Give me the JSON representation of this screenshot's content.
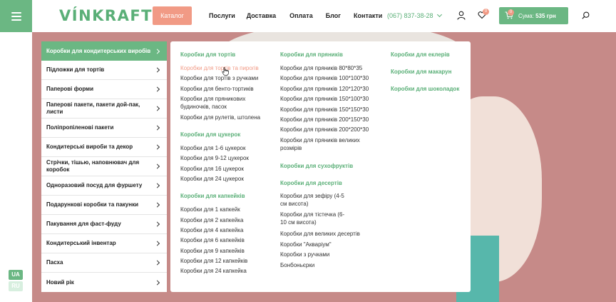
{
  "header": {
    "logo": "VÍNKRAFT",
    "catalog_button": "Каталог",
    "nav": [
      "Послуги",
      "Доставка",
      "Оплата",
      "Блог",
      "Контакти"
    ],
    "phone": "(067) 837-38-28",
    "favorites_count": "0",
    "cart_count": "0",
    "cart_sum_label": "Сума:",
    "cart_sum_value": "535 грн"
  },
  "languages": {
    "ua": "UA",
    "ru": "RU"
  },
  "categories": [
    "Коробки для кондитерських виробів",
    "Підложки для тортів",
    "Паперові форми",
    "Паперові пакети, пакети дой-пак, листи",
    "Поліпропіленові пакети",
    "Кондитерські вироби та декор",
    "Стрічки, тішью, наповнювач для коробок",
    "Одноразовий посуд для фуршету",
    "Подарункові коробки та пакунки",
    "Пакування для фаст-фуду",
    "Кондитерський інвентар",
    "Пасха",
    "Новий рік"
  ],
  "menu": {
    "cakes": {
      "title": "Коробки для тортів",
      "items": [
        "Коробки для тортів та пирогів",
        "Коробки для тортів з ручками",
        "Коробки для бенто-тортиків",
        "Коробки для пряникових будиночків, пасок",
        "Коробки для рулетів, штолена"
      ]
    },
    "candies": {
      "title": "Коробки для цукерок",
      "items": [
        "Коробки для 1-6 цукерок",
        "Коробки для 9-12 цукерок",
        "Коробки для 16 цукерок",
        "Коробки для 24 цукерок"
      ]
    },
    "cupcakes": {
      "title": "Коробки для капкейків",
      "items": [
        "Коробки для 1 капкейк",
        "Коробки для 2 капкейка",
        "Коробки для 4 капкейка",
        "Коробки для 6 капкейків",
        "Коробки для 9 капкейків",
        "Коробки для 12 капкейків",
        "Коробки для 24 капкейка"
      ]
    },
    "gingerbread": {
      "title": "Коробки для пряників",
      "items": [
        "Коробки для пряників 80*80*35",
        "Коробки для пряників 100*100*30",
        "Коробки для пряників 120*120*30",
        "Коробки для пряників 150*100*30",
        "Коробки для пряників 150*150*30",
        "Коробки для пряників 200*150*30",
        "Коробки для пряників 200*200*30",
        "Коробки для пряників великих розмірів"
      ]
    },
    "dried_fruits": {
      "title": "Коробки для сухофруктів"
    },
    "desserts": {
      "title": "Коробки для десертів",
      "items": [
        "Коробки для зефіру (4-5 см висота)",
        "Коробки для тістечка (6-10 см висота)",
        "Коробки для великих десертів",
        "Коробки \"Акваріум\"",
        "Коробки з ручками",
        "Бонбоньєрки"
      ]
    },
    "eclairs": {
      "title": "Коробки для еклерів"
    },
    "macarons": {
      "title": "Коробки для макарун"
    },
    "chocolate": {
      "title": "Коробки для шоколадок"
    }
  },
  "colors": {
    "brand_green": "#6bb783",
    "accent_coral": "#f19a85"
  }
}
